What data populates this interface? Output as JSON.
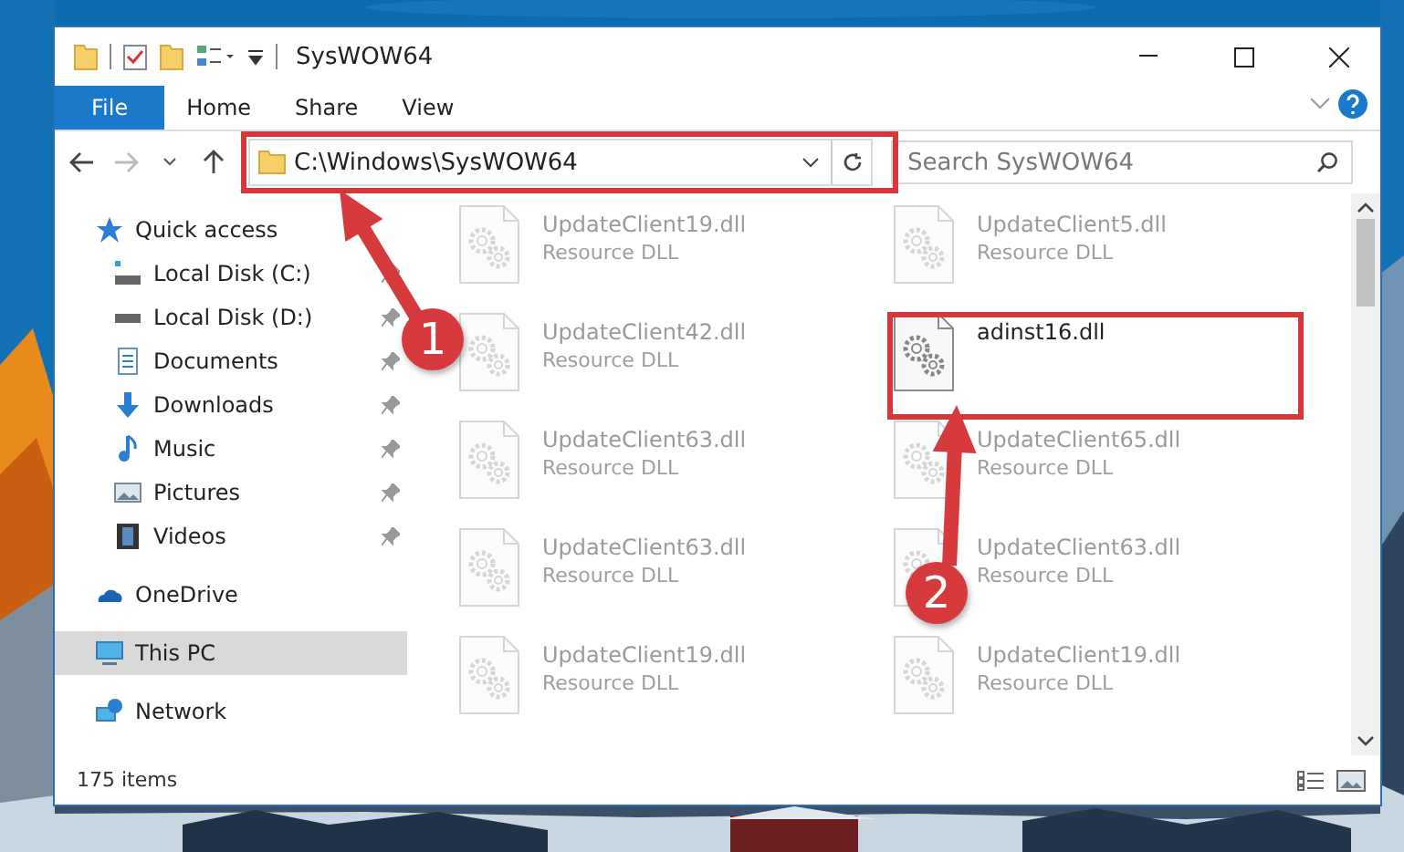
{
  "window": {
    "title": "SysWOW64"
  },
  "ribbon": {
    "tabs": [
      {
        "label": "File",
        "selected": true
      },
      {
        "label": "Home",
        "selected": false
      },
      {
        "label": "Share",
        "selected": false
      },
      {
        "label": "View",
        "selected": false
      }
    ]
  },
  "address": {
    "path": "C:\\Windows\\SysWOW64"
  },
  "search": {
    "placeholder": "Search SysWOW64"
  },
  "sidebar": {
    "items": [
      {
        "label": "Quick access",
        "kind": "star",
        "selected": false,
        "children": [
          {
            "label": "Local Disk (C:)",
            "kind": "disk-c",
            "pinned": true,
            "selected": false
          },
          {
            "label": "Local Disk (D:)",
            "kind": "disk",
            "pinned": true,
            "selected": false
          },
          {
            "label": "Documents",
            "kind": "documents",
            "pinned": true,
            "selected": false
          },
          {
            "label": "Downloads",
            "kind": "downloads",
            "pinned": true,
            "selected": false
          },
          {
            "label": "Music",
            "kind": "music",
            "pinned": true,
            "selected": false
          },
          {
            "label": "Pictures",
            "kind": "pictures",
            "pinned": true,
            "selected": false
          },
          {
            "label": "Videos",
            "kind": "videos",
            "pinned": true,
            "selected": false
          }
        ]
      },
      {
        "label": "OneDrive",
        "kind": "cloud",
        "selected": false
      },
      {
        "label": "This PC",
        "kind": "pc",
        "selected": true
      },
      {
        "label": "Network",
        "kind": "network",
        "selected": false
      }
    ]
  },
  "files": [
    {
      "name": "UpdateClient19.dll",
      "type": "Resource DLL",
      "dimmed": true
    },
    {
      "name": "UpdateClient5.dll",
      "type": "Resource DLL",
      "dimmed": true
    },
    {
      "name": "UpdateClient42.dll",
      "type": "Resource DLL",
      "dimmed": true
    },
    {
      "name": "adinst16.dll",
      "dimmed": false
    },
    {
      "name": "UpdateClient63.dll",
      "type": "Resource DLL",
      "dimmed": true
    },
    {
      "name": "UpdateClient65.dll",
      "type": "Resource DLL",
      "dimmed": true
    },
    {
      "name": "UpdateClient63.dll",
      "type": "Resource DLL",
      "dimmed": true
    },
    {
      "name": "UpdateClient63.dll",
      "type": "Resource DLL",
      "dimmed": true
    },
    {
      "name": "UpdateClient19.dll",
      "type": "Resource DLL",
      "dimmed": true
    },
    {
      "name": "UpdateClient19.dll",
      "type": "Resource DLL",
      "dimmed": true
    }
  ],
  "status_bar": {
    "item_count": "175 items"
  },
  "annotations": [
    {
      "label": "1"
    },
    {
      "label": "2"
    }
  ]
}
